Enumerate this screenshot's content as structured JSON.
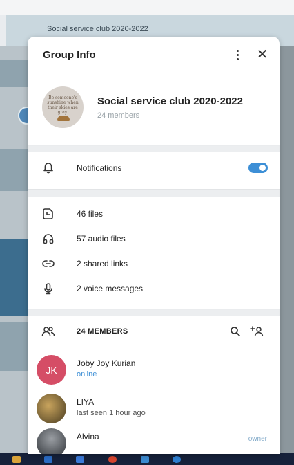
{
  "background": {
    "chat_title": "Social service club 2020-2022"
  },
  "dialog": {
    "title": "Group Info",
    "close_glyph": "✕",
    "group": {
      "name": "Social service club 2020-2022",
      "members": "24 members",
      "avatar_text": "Be someone's sunshine when their skies are gray."
    },
    "notifications": {
      "label": "Notifications",
      "enabled": true
    },
    "media": [
      {
        "icon": "clock-file-icon",
        "label": "46 files"
      },
      {
        "icon": "headphones-icon",
        "label": "57 audio files"
      },
      {
        "icon": "link-icon",
        "label": "2 shared links"
      },
      {
        "icon": "microphone-icon",
        "label": "2 voice messages"
      }
    ],
    "members_section": {
      "title": "24 MEMBERS",
      "list": [
        {
          "initials": "JK",
          "name": "Joby Joy Kurian",
          "status": "online",
          "avatar_color": "#d54d66",
          "role": ""
        },
        {
          "initials": "",
          "name": "LIYA",
          "status": "last seen 1 hour ago",
          "avatar_color": "#8a7a52",
          "role": ""
        },
        {
          "initials": "",
          "name": "Alvina",
          "status": "",
          "avatar_color": "#6b6e72",
          "role": "owner"
        }
      ]
    }
  },
  "colors": {
    "accent": "#3d8fd6",
    "online": "#3d8fd6",
    "muted": "#9aa3a8"
  }
}
